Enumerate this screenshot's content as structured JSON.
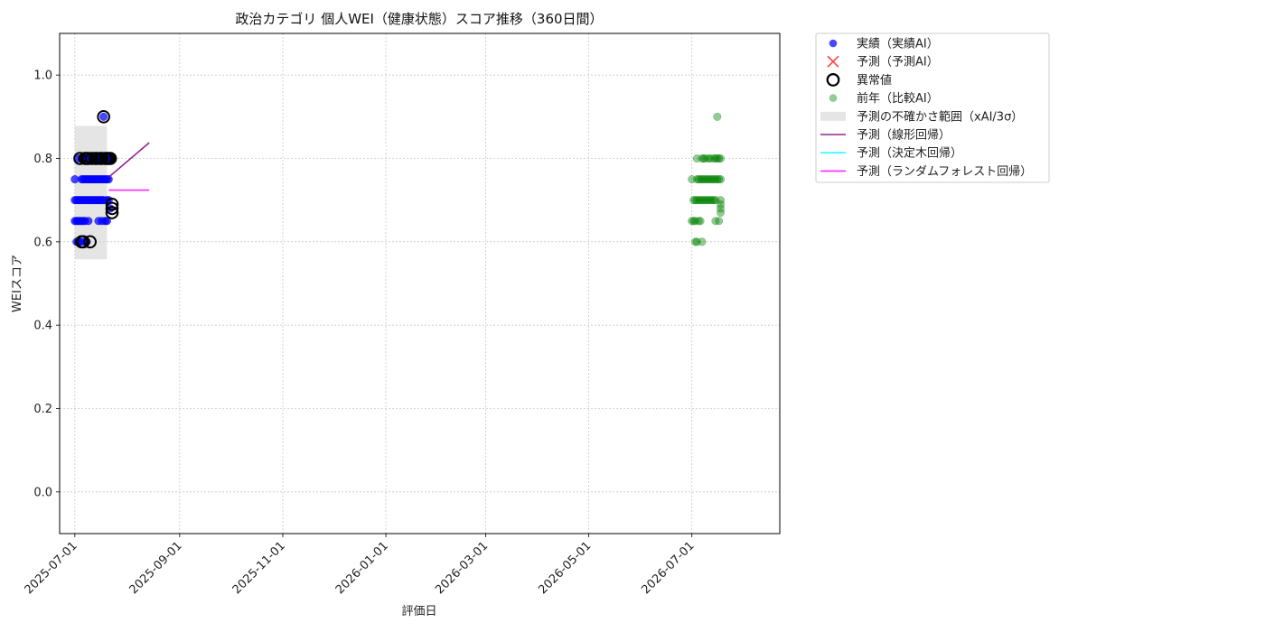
{
  "chart_data": {
    "type": "scatter",
    "title": "政治カテゴリ 個人WEI（健康状態）スコア推移（360日間）",
    "xlabel": "評価日",
    "ylabel": "WEIスコア",
    "xlim": [
      "2025-06-22",
      "2026-08-22"
    ],
    "ylim": [
      -0.1,
      1.1
    ],
    "x_ticks": [
      "2025-07-01",
      "2025-09-01",
      "2025-11-01",
      "2026-01-01",
      "2026-03-01",
      "2026-05-01",
      "2026-07-01"
    ],
    "y_ticks": [
      0.0,
      0.2,
      0.4,
      0.6,
      0.8,
      1.0
    ],
    "y_tick_labels": [
      "0.0",
      "0.2",
      "0.4",
      "0.6",
      "0.8",
      "1.0"
    ],
    "grid": true,
    "legend_position": "outside upper right",
    "colors": {
      "actual": "#0000ff",
      "predicted": "#ff0000",
      "anomaly_edge": "#000000",
      "previous_year": "#008000",
      "uncertainty": "#d3d3d3",
      "linear": "#800080",
      "tree": "#00ffff",
      "forest": "#ff00ff"
    },
    "series": [
      {
        "name": "実績（実績AI）",
        "kind": "scatter",
        "color": "#0000ff",
        "points": [
          [
            "2025-07-01",
            0.75
          ],
          [
            "2025-07-01",
            0.7
          ],
          [
            "2025-07-01",
            0.65
          ],
          [
            "2025-07-02",
            0.7
          ],
          [
            "2025-07-02",
            0.65
          ],
          [
            "2025-07-02",
            0.6
          ],
          [
            "2025-07-03",
            0.8
          ],
          [
            "2025-07-03",
            0.7
          ],
          [
            "2025-07-03",
            0.65
          ],
          [
            "2025-07-03",
            0.6
          ],
          [
            "2025-07-04",
            0.7
          ],
          [
            "2025-07-04",
            0.65
          ],
          [
            "2025-07-04",
            0.6
          ],
          [
            "2025-07-05",
            0.75
          ],
          [
            "2025-07-05",
            0.8
          ],
          [
            "2025-07-05",
            0.7
          ],
          [
            "2025-07-05",
            0.65
          ],
          [
            "2025-07-06",
            0.75
          ],
          [
            "2025-07-06",
            0.7
          ],
          [
            "2025-07-06",
            0.65
          ],
          [
            "2025-07-06",
            0.6
          ],
          [
            "2025-07-07",
            0.8
          ],
          [
            "2025-07-07",
            0.75
          ],
          [
            "2025-07-07",
            0.7
          ],
          [
            "2025-07-07",
            0.65
          ],
          [
            "2025-07-08",
            0.8
          ],
          [
            "2025-07-08",
            0.75
          ],
          [
            "2025-07-08",
            0.7
          ],
          [
            "2025-07-08",
            0.6
          ],
          [
            "2025-07-09",
            0.75
          ],
          [
            "2025-07-09",
            0.7
          ],
          [
            "2025-07-09",
            0.65
          ],
          [
            "2025-07-10",
            0.8
          ],
          [
            "2025-07-10",
            0.75
          ],
          [
            "2025-07-10",
            0.7
          ],
          [
            "2025-07-11",
            0.8
          ],
          [
            "2025-07-11",
            0.75
          ],
          [
            "2025-07-11",
            0.7
          ],
          [
            "2025-07-12",
            0.8
          ],
          [
            "2025-07-12",
            0.75
          ],
          [
            "2025-07-12",
            0.7
          ],
          [
            "2025-07-13",
            0.8
          ],
          [
            "2025-07-13",
            0.75
          ],
          [
            "2025-07-13",
            0.7
          ],
          [
            "2025-07-14",
            0.8
          ],
          [
            "2025-07-14",
            0.75
          ],
          [
            "2025-07-14",
            0.7
          ],
          [
            "2025-07-15",
            0.8
          ],
          [
            "2025-07-15",
            0.75
          ],
          [
            "2025-07-15",
            0.7
          ],
          [
            "2025-07-15",
            0.65
          ],
          [
            "2025-07-16",
            0.8
          ],
          [
            "2025-07-16",
            0.75
          ],
          [
            "2025-07-16",
            0.7
          ],
          [
            "2025-07-17",
            0.8
          ],
          [
            "2025-07-17",
            0.75
          ],
          [
            "2025-07-17",
            0.7
          ],
          [
            "2025-07-17",
            0.65
          ],
          [
            "2025-07-18",
            0.9
          ],
          [
            "2025-07-18",
            0.8
          ],
          [
            "2025-07-18",
            0.75
          ],
          [
            "2025-07-18",
            0.7
          ],
          [
            "2025-07-19",
            0.8
          ],
          [
            "2025-07-19",
            0.75
          ],
          [
            "2025-07-19",
            0.65
          ],
          [
            "2025-07-20",
            0.8
          ],
          [
            "2025-07-20",
            0.75
          ],
          [
            "2025-07-20",
            0.7
          ],
          [
            "2025-07-20",
            0.65
          ],
          [
            "2025-07-21",
            0.8
          ],
          [
            "2025-07-21",
            0.75
          ],
          [
            "2025-07-21",
            0.7
          ],
          [
            "2025-07-22",
            0.8
          ],
          [
            "2025-07-22",
            0.68
          ]
        ]
      },
      {
        "name": "予測（予測AI）",
        "kind": "scatter-x",
        "color": "#ff0000",
        "points": []
      },
      {
        "name": "異常値",
        "kind": "ring",
        "color": "#000000",
        "points": [
          [
            "2025-07-04",
            0.8
          ],
          [
            "2025-07-05",
            0.6
          ],
          [
            "2025-07-06",
            0.6
          ],
          [
            "2025-07-07",
            0.8
          ],
          [
            "2025-07-08",
            0.8
          ],
          [
            "2025-07-09",
            0.8
          ],
          [
            "2025-07-10",
            0.6
          ],
          [
            "2025-07-11",
            0.8
          ],
          [
            "2025-07-13",
            0.8
          ],
          [
            "2025-07-14",
            0.8
          ],
          [
            "2025-07-16",
            0.8
          ],
          [
            "2025-07-17",
            0.8
          ],
          [
            "2025-07-18",
            0.9
          ],
          [
            "2025-07-19",
            0.8
          ],
          [
            "2025-07-20",
            0.8
          ],
          [
            "2025-07-21",
            0.8
          ],
          [
            "2025-07-22",
            0.8
          ],
          [
            "2025-07-23",
            0.69
          ],
          [
            "2025-07-23",
            0.68
          ],
          [
            "2025-07-23",
            0.67
          ]
        ]
      },
      {
        "name": "前年（比較AI）",
        "kind": "scatter",
        "color": "#008000",
        "points": [
          [
            "2026-07-01",
            0.75
          ],
          [
            "2026-07-01",
            0.65
          ],
          [
            "2026-07-02",
            0.7
          ],
          [
            "2026-07-02",
            0.65
          ],
          [
            "2026-07-03",
            0.7
          ],
          [
            "2026-07-03",
            0.65
          ],
          [
            "2026-07-03",
            0.6
          ],
          [
            "2026-07-04",
            0.8
          ],
          [
            "2026-07-04",
            0.75
          ],
          [
            "2026-07-04",
            0.7
          ],
          [
            "2026-07-04",
            0.6
          ],
          [
            "2026-07-05",
            0.75
          ],
          [
            "2026-07-05",
            0.7
          ],
          [
            "2026-07-05",
            0.65
          ],
          [
            "2026-07-06",
            0.75
          ],
          [
            "2026-07-06",
            0.7
          ],
          [
            "2026-07-06",
            0.65
          ],
          [
            "2026-07-07",
            0.8
          ],
          [
            "2026-07-07",
            0.75
          ],
          [
            "2026-07-07",
            0.7
          ],
          [
            "2026-07-07",
            0.6
          ],
          [
            "2026-07-08",
            0.8
          ],
          [
            "2026-07-08",
            0.75
          ],
          [
            "2026-07-08",
            0.7
          ],
          [
            "2026-07-09",
            0.8
          ],
          [
            "2026-07-09",
            0.75
          ],
          [
            "2026-07-09",
            0.7
          ],
          [
            "2026-07-10",
            0.75
          ],
          [
            "2026-07-10",
            0.7
          ],
          [
            "2026-07-11",
            0.8
          ],
          [
            "2026-07-11",
            0.75
          ],
          [
            "2026-07-11",
            0.7
          ],
          [
            "2026-07-12",
            0.8
          ],
          [
            "2026-07-12",
            0.75
          ],
          [
            "2026-07-12",
            0.7
          ],
          [
            "2026-07-13",
            0.75
          ],
          [
            "2026-07-13",
            0.7
          ],
          [
            "2026-07-14",
            0.8
          ],
          [
            "2026-07-14",
            0.75
          ],
          [
            "2026-07-14",
            0.7
          ],
          [
            "2026-07-15",
            0.8
          ],
          [
            "2026-07-15",
            0.75
          ],
          [
            "2026-07-15",
            0.7
          ],
          [
            "2026-07-15",
            0.65
          ],
          [
            "2026-07-16",
            0.9
          ],
          [
            "2026-07-16",
            0.8
          ],
          [
            "2026-07-16",
            0.75
          ],
          [
            "2026-07-17",
            0.8
          ],
          [
            "2026-07-17",
            0.75
          ],
          [
            "2026-07-17",
            0.65
          ],
          [
            "2026-07-18",
            0.8
          ],
          [
            "2026-07-18",
            0.75
          ],
          [
            "2026-07-18",
            0.7
          ],
          [
            "2026-07-18",
            0.69
          ],
          [
            "2026-07-18",
            0.68
          ],
          [
            "2026-07-18",
            0.67
          ]
        ]
      },
      {
        "name": "予測の不確かさ範囲（xAI/3σ）",
        "kind": "band",
        "color": "#d3d3d3",
        "x_range": [
          "2025-07-01",
          "2025-07-20"
        ],
        "y_range": [
          0.558,
          0.878
        ]
      },
      {
        "name": "予測（線形回帰）",
        "kind": "line",
        "color": "#800080",
        "points": [
          [
            "2025-07-21",
            0.755
          ],
          [
            "2025-08-14",
            0.838
          ]
        ]
      },
      {
        "name": "予測（決定木回帰）",
        "kind": "line",
        "color": "#00ffff",
        "points": []
      },
      {
        "name": "予測（ランダムフォレスト回帰）",
        "kind": "line",
        "color": "#ff00ff",
        "points": [
          [
            "2025-07-21",
            0.724
          ],
          [
            "2025-08-14",
            0.724
          ]
        ]
      }
    ]
  }
}
